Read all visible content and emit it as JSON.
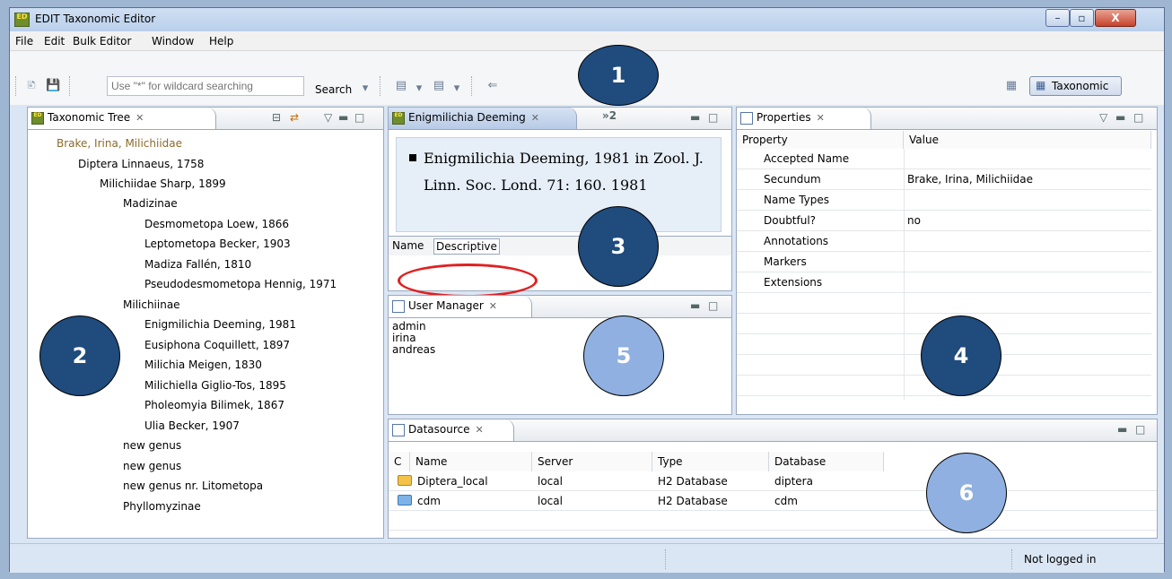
{
  "window": {
    "title": "EDIT Taxonomic Editor",
    "logo_text": "ED",
    "controls": {
      "minimize": "–",
      "maximize": "▫",
      "close": "X"
    }
  },
  "menu": [
    "File",
    "Edit",
    "Bulk Editor",
    "Window",
    "Help"
  ],
  "toolbar": {
    "search_placeholder": "Use \"*\" for wildcard searching",
    "search_label": "Search",
    "perspective": "Taxonomic"
  },
  "taxonomic_tree": {
    "title": "Taxonomic Tree",
    "items": [
      {
        "label": "Brake, Irina, Milichiidae",
        "level": 0
      },
      {
        "label": "Diptera Linnaeus, 1758",
        "level": 1
      },
      {
        "label": "Milichiidae Sharp, 1899",
        "level": 2
      },
      {
        "label": "Madizinae",
        "level": 3
      },
      {
        "label": "Desmometopa Loew, 1866",
        "level": 4
      },
      {
        "label": "Leptometopa Becker, 1903",
        "level": 4
      },
      {
        "label": "Madiza Fallén, 1810",
        "level": 4
      },
      {
        "label": "Pseudodesmometopa Hennig, 1971",
        "level": 4
      },
      {
        "label": "Milichiinae",
        "level": 3
      },
      {
        "label": "Enigmilichia Deeming, 1981",
        "level": 4
      },
      {
        "label": "Eusiphona Coquillett, 1897",
        "level": 4
      },
      {
        "label": "Milichia Meigen, 1830",
        "level": 4
      },
      {
        "label": "Milichiella Giglio-Tos, 1895",
        "level": 4
      },
      {
        "label": "Pholeomyia Bilimek, 1867",
        "level": 4
      },
      {
        "label": "Ulia Becker, 1907",
        "level": 4
      },
      {
        "label": "new genus",
        "level": 3
      },
      {
        "label": "new genus",
        "level": 3
      },
      {
        "label": "new genus nr. Litometopa",
        "level": 3
      },
      {
        "label": "Phyllomyzinae",
        "level": 3
      }
    ]
  },
  "editor": {
    "tab_title": "Enigmilichia Deeming",
    "overflow": "»2",
    "name_text": "Enigmilichia Deeming, 1981 in Zool. J. Linn. Soc. Lond. 71: 160. 1981",
    "tabs": [
      "Name",
      "Descriptive"
    ]
  },
  "properties": {
    "title": "Properties",
    "columns": [
      "Property",
      "Value"
    ],
    "rows": [
      {
        "name": "Accepted Name",
        "value": ""
      },
      {
        "name": "Secundum",
        "value": "Brake, Irina, Milichiidae"
      },
      {
        "name": "Name Types",
        "value": ""
      },
      {
        "name": "Doubtful?",
        "value": "no"
      },
      {
        "name": "Annotations",
        "value": ""
      },
      {
        "name": "Markers",
        "value": ""
      },
      {
        "name": "Extensions",
        "value": ""
      }
    ]
  },
  "user_manager": {
    "title": "User Manager",
    "users": [
      "admin",
      "irina",
      "andreas"
    ]
  },
  "datasource": {
    "title": "Datasource",
    "columns": [
      "C",
      "Name",
      "Server",
      "Type",
      "Database"
    ],
    "rows": [
      {
        "name": "Diptera_local",
        "server": "local",
        "type": "H2 Database",
        "database": "diptera"
      },
      {
        "name": "cdm",
        "server": "local",
        "type": "H2 Database",
        "database": "cdm"
      }
    ]
  },
  "status": {
    "login": "Not logged in"
  },
  "callouts": [
    "1",
    "2",
    "3",
    "4",
    "5",
    "6"
  ],
  "colors": {
    "callout_dark": "#1f4b7d",
    "callout_light": "#8fb0e0",
    "highlight_oval": "#e02020"
  }
}
